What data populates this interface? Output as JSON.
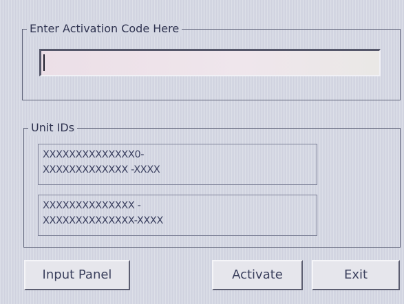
{
  "activation": {
    "legend": "Enter Activation Code Here",
    "code_value": ""
  },
  "units": {
    "legend": "Unit IDs",
    "items": [
      {
        "line1": "XXXXXXXXXXXXXX0-",
        "line2": "XXXXXXXXXXXXX -XXXX"
      },
      {
        "line1": "XXXXXXXXXXXXXX -",
        "line2": "XXXXXXXXXXXXXX-XXXX"
      }
    ]
  },
  "buttons": {
    "input_panel": "Input Panel",
    "activate": "Activate",
    "exit": "Exit"
  }
}
